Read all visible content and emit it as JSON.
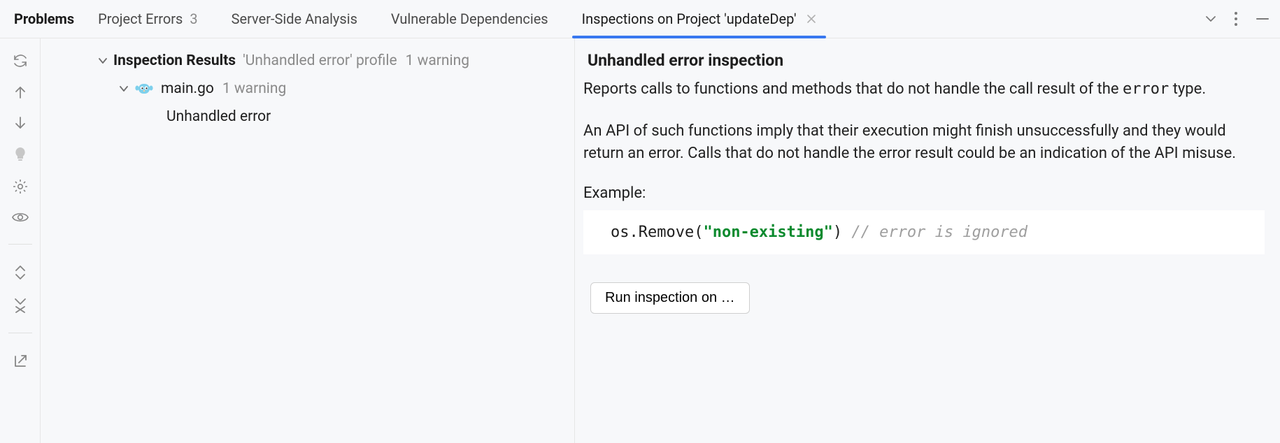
{
  "tabs": {
    "problems": "Problems",
    "project_errors": {
      "label": "Project Errors",
      "count": "3"
    },
    "server_side": "Server-Side Analysis",
    "vuln_deps": "Vulnerable Dependencies",
    "inspections": "Inspections on Project 'updateDep'"
  },
  "tree": {
    "root_title": "Inspection Results",
    "root_profile": "'Unhandled error' profile",
    "root_count": "1 warning",
    "file_name": "main.go",
    "file_count": "1 warning",
    "issue": "Unhandled error"
  },
  "detail": {
    "title": "Unhandled error inspection",
    "p1a": "Reports calls to functions and methods that do not handle the call result of the ",
    "p1code": "error",
    "p1b": " type.",
    "p2": "An API of such functions imply that their execution might finish unsuccessfully and they would return an error. Calls that do not handle the error result could be an indication of the API misuse.",
    "example_label": "Example:",
    "code_pre": "os.Remove(",
    "code_str": "\"non-existing\"",
    "code_post": ") ",
    "code_cmt": "// error is ignored",
    "run_button": "Run inspection on …"
  }
}
